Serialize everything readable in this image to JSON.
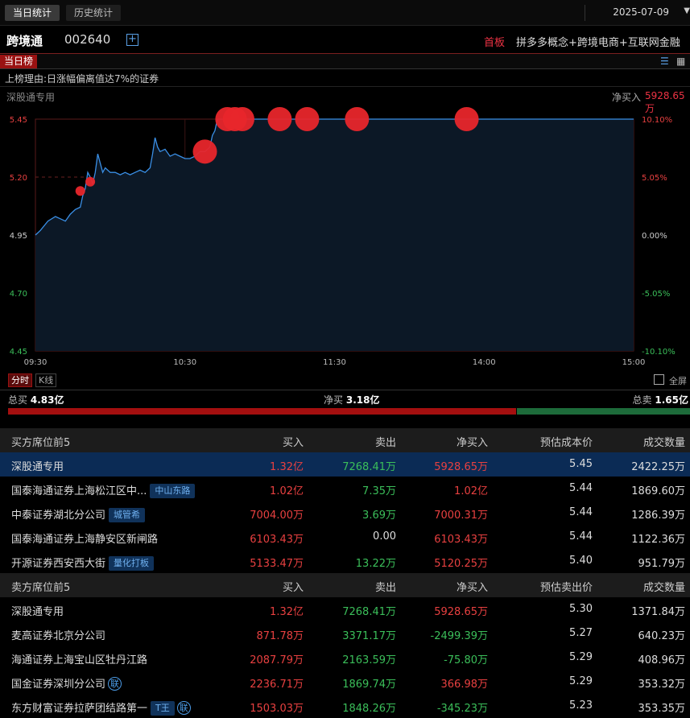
{
  "tabs": {
    "today": "当日统计",
    "history": "历史统计"
  },
  "date": "2025-07-09",
  "stock": {
    "name": "跨境通",
    "code": "002640",
    "add_symbol": "+",
    "board": "首板",
    "concepts": "拼多多概念+跨境电商+互联网金融"
  },
  "list_tag": "当日榜",
  "reason": "上榜理由:日涨幅偏离值达7%的证券",
  "seat": {
    "name": "深股通专用",
    "netbuy_label": "净买入",
    "netbuy_value": "5928.65万"
  },
  "colors": {
    "up": "#e84040",
    "down": "#3bbf5a",
    "line": "#3a8fe6",
    "accent": "#9a1212"
  },
  "chart_data": {
    "type": "line",
    "x_ticks": [
      "09:30",
      "10:30",
      "11:30",
      "14:00",
      "15:00"
    ],
    "y_ticks_left": [
      "5.45",
      "5.20",
      "4.95",
      "4.70",
      "4.45"
    ],
    "y_ticks_right": [
      "10.10%",
      "5.05%",
      "0.00%",
      "-5.05%",
      "-10.10%"
    ],
    "ylim": [
      4.45,
      5.45
    ],
    "prev_close": 4.95,
    "minutes_total": 240,
    "price_series": [
      [
        0,
        4.95
      ],
      [
        2,
        4.97
      ],
      [
        5,
        5.01
      ],
      [
        8,
        5.03
      ],
      [
        10,
        5.02
      ],
      [
        12,
        5.01
      ],
      [
        14,
        5.04
      ],
      [
        16,
        5.06
      ],
      [
        18,
        5.07
      ],
      [
        19,
        5.12
      ],
      [
        20,
        5.15
      ],
      [
        21,
        5.22
      ],
      [
        22,
        5.2
      ],
      [
        23,
        5.17
      ],
      [
        24,
        5.22
      ],
      [
        25,
        5.3
      ],
      [
        26,
        5.26
      ],
      [
        27,
        5.22
      ],
      [
        28,
        5.24
      ],
      [
        30,
        5.22
      ],
      [
        32,
        5.22
      ],
      [
        34,
        5.21
      ],
      [
        36,
        5.22
      ],
      [
        38,
        5.21
      ],
      [
        40,
        5.22
      ],
      [
        42,
        5.23
      ],
      [
        44,
        5.22
      ],
      [
        46,
        5.24
      ],
      [
        47,
        5.3
      ],
      [
        48,
        5.37
      ],
      [
        49,
        5.33
      ],
      [
        50,
        5.31
      ],
      [
        52,
        5.32
      ],
      [
        54,
        5.29
      ],
      [
        56,
        5.3
      ],
      [
        58,
        5.29
      ],
      [
        60,
        5.28
      ],
      [
        62,
        5.28
      ],
      [
        64,
        5.29
      ],
      [
        66,
        5.31
      ],
      [
        68,
        5.31
      ],
      [
        70,
        5.33
      ],
      [
        71,
        5.38
      ],
      [
        72,
        5.4
      ],
      [
        73,
        5.45
      ],
      [
        240,
        5.45
      ]
    ],
    "markers": [
      {
        "t": 18,
        "price": 5.14,
        "size": "small"
      },
      {
        "t": 22,
        "price": 5.18,
        "size": "small"
      },
      {
        "t": 68,
        "price": 5.31,
        "size": "large"
      },
      {
        "t": 77,
        "price": 5.45,
        "size": "large"
      },
      {
        "t": 80,
        "price": 5.45,
        "size": "large"
      },
      {
        "t": 83,
        "price": 5.45,
        "size": "large"
      },
      {
        "t": 98,
        "price": 5.45,
        "size": "large"
      },
      {
        "t": 109,
        "price": 5.45,
        "size": "large"
      },
      {
        "t": 129,
        "price": 5.45,
        "size": "large"
      },
      {
        "t": 173,
        "price": 5.45,
        "size": "large"
      }
    ]
  },
  "chart_tabs": {
    "fenshi": "分时",
    "kline": "K线",
    "fullscreen": "全屏"
  },
  "totals": {
    "buy_label": "总买",
    "buy_value": "4.83亿",
    "net_label": "净买",
    "net_value": "3.18亿",
    "sell_label": "总卖",
    "sell_value": "1.65亿",
    "buy_ratio": 0.745
  },
  "buy_table": {
    "headers": [
      "买方席位前5",
      "买入",
      "卖出",
      "净买入",
      "预估成本价",
      "成交数量"
    ],
    "rows": [
      {
        "name": "深股通专用",
        "badge": "",
        "buy": "1.32亿",
        "sell": "7268.41万",
        "net": "5928.65万",
        "net_dir": "up",
        "price": "5.45",
        "vol": "2422.25万"
      },
      {
        "name": "国泰海通证券上海松江区中...",
        "badge": "中山东路",
        "buy": "1.02亿",
        "sell": "7.35万",
        "net": "1.02亿",
        "net_dir": "up",
        "price": "5.44",
        "vol": "1869.60万"
      },
      {
        "name": "中泰证券湖北分公司",
        "badge": "城管希",
        "buy": "7004.00万",
        "sell": "3.69万",
        "net": "7000.31万",
        "net_dir": "up",
        "price": "5.44",
        "vol": "1286.39万"
      },
      {
        "name": "国泰海通证券上海静安区新闸路",
        "badge": "",
        "buy": "6103.43万",
        "sell": "0.00",
        "net": "6103.43万",
        "net_dir": "up",
        "price": "5.44",
        "vol": "1122.36万"
      },
      {
        "name": "开源证券西安西大街",
        "badge": "量化打板",
        "buy": "5133.47万",
        "sell": "13.22万",
        "net": "5120.25万",
        "net_dir": "up",
        "price": "5.40",
        "vol": "951.79万"
      }
    ]
  },
  "sell_table": {
    "headers": [
      "卖方席位前5",
      "买入",
      "卖出",
      "净买入",
      "预估卖出价",
      "成交数量"
    ],
    "rows": [
      {
        "name": "深股通专用",
        "badge": "",
        "circle": "",
        "buy": "1.32亿",
        "sell": "7268.41万",
        "net": "5928.65万",
        "net_dir": "up",
        "price": "5.30",
        "vol": "1371.84万"
      },
      {
        "name": "麦高证券北京分公司",
        "badge": "",
        "circle": "",
        "buy": "871.78万",
        "sell": "3371.17万",
        "net": "-2499.39万",
        "net_dir": "down",
        "price": "5.27",
        "vol": "640.23万"
      },
      {
        "name": "海通证券上海宝山区牡丹江路",
        "badge": "",
        "circle": "",
        "buy": "2087.79万",
        "sell": "2163.59万",
        "net": "-75.80万",
        "net_dir": "down",
        "price": "5.29",
        "vol": "408.96万"
      },
      {
        "name": "国金证券深圳分公司",
        "badge": "",
        "circle": "联",
        "buy": "2236.71万",
        "sell": "1869.74万",
        "net": "366.98万",
        "net_dir": "up",
        "price": "5.29",
        "vol": "353.32万"
      },
      {
        "name": "东方财富证券拉萨团结路第一",
        "badge": "T王",
        "circle": "联",
        "buy": "1503.03万",
        "sell": "1848.26万",
        "net": "-345.23万",
        "net_dir": "down",
        "price": "5.23",
        "vol": "353.35万"
      }
    ]
  }
}
